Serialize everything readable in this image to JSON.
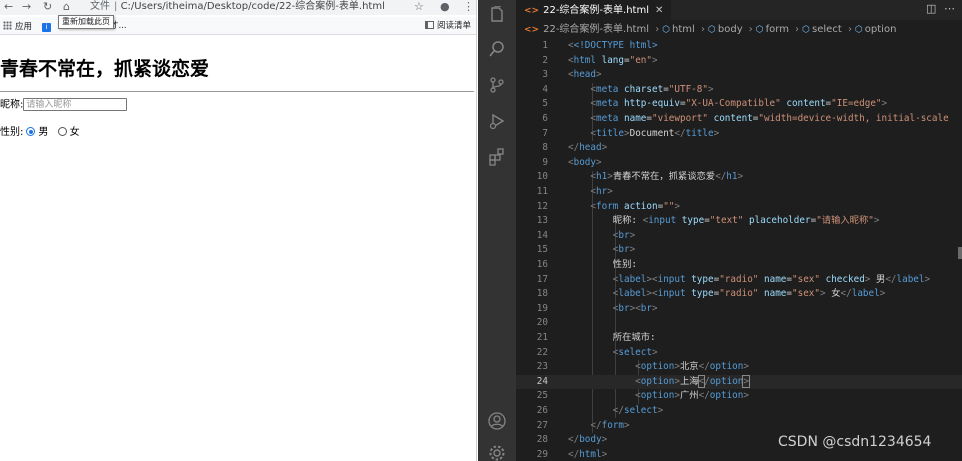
{
  "browser": {
    "address_label": "文件",
    "address_path": "C:/Users/itheima/Desktop/code/22-综合案例-表单.html",
    "tooltip": "重新加载此页",
    "bookmarks": {
      "apps_label": "应用",
      "item_label": "才...",
      "reading_list_label": "阅读清单"
    },
    "page": {
      "heading": "青春不常在，抓紧谈恋爱",
      "nickname_label": "昵称:",
      "nickname_placeholder": "请输入昵称",
      "sex_label": "性别:",
      "male_label": "男",
      "female_label": "女"
    }
  },
  "editor": {
    "tab_title": "22-综合案例-表单.html",
    "breadcrumb": [
      "22-综合案例-表单.html",
      "html",
      "body",
      "form",
      "select",
      "option"
    ],
    "active_line": 24,
    "lines": [
      {
        "n": "1"
      },
      {
        "n": "2"
      },
      {
        "n": "3"
      },
      {
        "n": "4"
      },
      {
        "n": "5"
      },
      {
        "n": "6"
      },
      {
        "n": "7"
      },
      {
        "n": "8"
      },
      {
        "n": "9"
      },
      {
        "n": "10"
      },
      {
        "n": "11"
      },
      {
        "n": "12"
      },
      {
        "n": "13"
      },
      {
        "n": "14"
      },
      {
        "n": "15"
      },
      {
        "n": "16"
      },
      {
        "n": "17"
      },
      {
        "n": "18"
      },
      {
        "n": "19"
      },
      {
        "n": "20"
      },
      {
        "n": "21"
      },
      {
        "n": "22"
      },
      {
        "n": "23"
      },
      {
        "n": "24"
      },
      {
        "n": "25"
      },
      {
        "n": "26"
      },
      {
        "n": "27"
      },
      {
        "n": "28"
      },
      {
        "n": "29"
      }
    ],
    "code": {
      "l1": "<!DOCTYPE html>",
      "l2_tag": "html",
      "l2_attr": "lang",
      "l2_val": "\"en\"",
      "l3": "head",
      "l4_tag": "meta",
      "l4_attr": "charset",
      "l4_val": "\"UTF-8\"",
      "l5_tag": "meta",
      "l5_attr1": "http-equiv",
      "l5_val1": "\"X-UA-Compatible\"",
      "l5_attr2": "content",
      "l5_val2": "\"IE=edge\"",
      "l6_tag": "meta",
      "l6_attr1": "name",
      "l6_val1": "\"viewport\"",
      "l6_attr2": "content",
      "l6_val2": "\"width=device-width, initial-scale",
      "l7_tag": "title",
      "l7_text": "Document",
      "l8": "head",
      "l9": "body",
      "l10_tag": "h1",
      "l10_text": "青春不常在，抓紧谈恋爱",
      "l11": "hr",
      "l12_tag": "form",
      "l12_attr": "action",
      "l12_val": "\"\"",
      "l13_text": "昵称: ",
      "l13_tag": "input",
      "l13_attr1": "type",
      "l13_val1": "\"text\"",
      "l13_attr2": "placeholder",
      "l13_val2": "\"请输入昵称\"",
      "l14": "br",
      "l15": "br",
      "l16_text": "性别:",
      "l17_label": "label",
      "l17_tag": "input",
      "l17_attr1": "type",
      "l17_val1": "\"radio\"",
      "l17_attr2": "name",
      "l17_val2": "\"sex\"",
      "l17_attr3": "checked",
      "l17_text": " 男",
      "l18_label": "label",
      "l18_tag": "input",
      "l18_attr1": "type",
      "l18_val1": "\"radio\"",
      "l18_attr2": "name",
      "l18_val2": "\"sex\"",
      "l18_text": " 女",
      "l19": "br",
      "l21_text": "所在城市:",
      "l22": "select",
      "l23_tag": "option",
      "l23_text": "北京",
      "l24_tag": "option",
      "l24_text": "上海",
      "l25_tag": "option",
      "l25_text": "广州",
      "l26": "select",
      "l27": "form",
      "l28": "body",
      "l29": "html"
    }
  },
  "watermark": "CSDN @csdn1234654",
  "colors": {
    "editor_bg": "#1e1e1e",
    "activity_bar": "#333333",
    "tag_blue": "#569cd6",
    "attr_light_blue": "#9cdcfe",
    "string_orange": "#ce9178",
    "radio_checked": "#1a73e8"
  }
}
